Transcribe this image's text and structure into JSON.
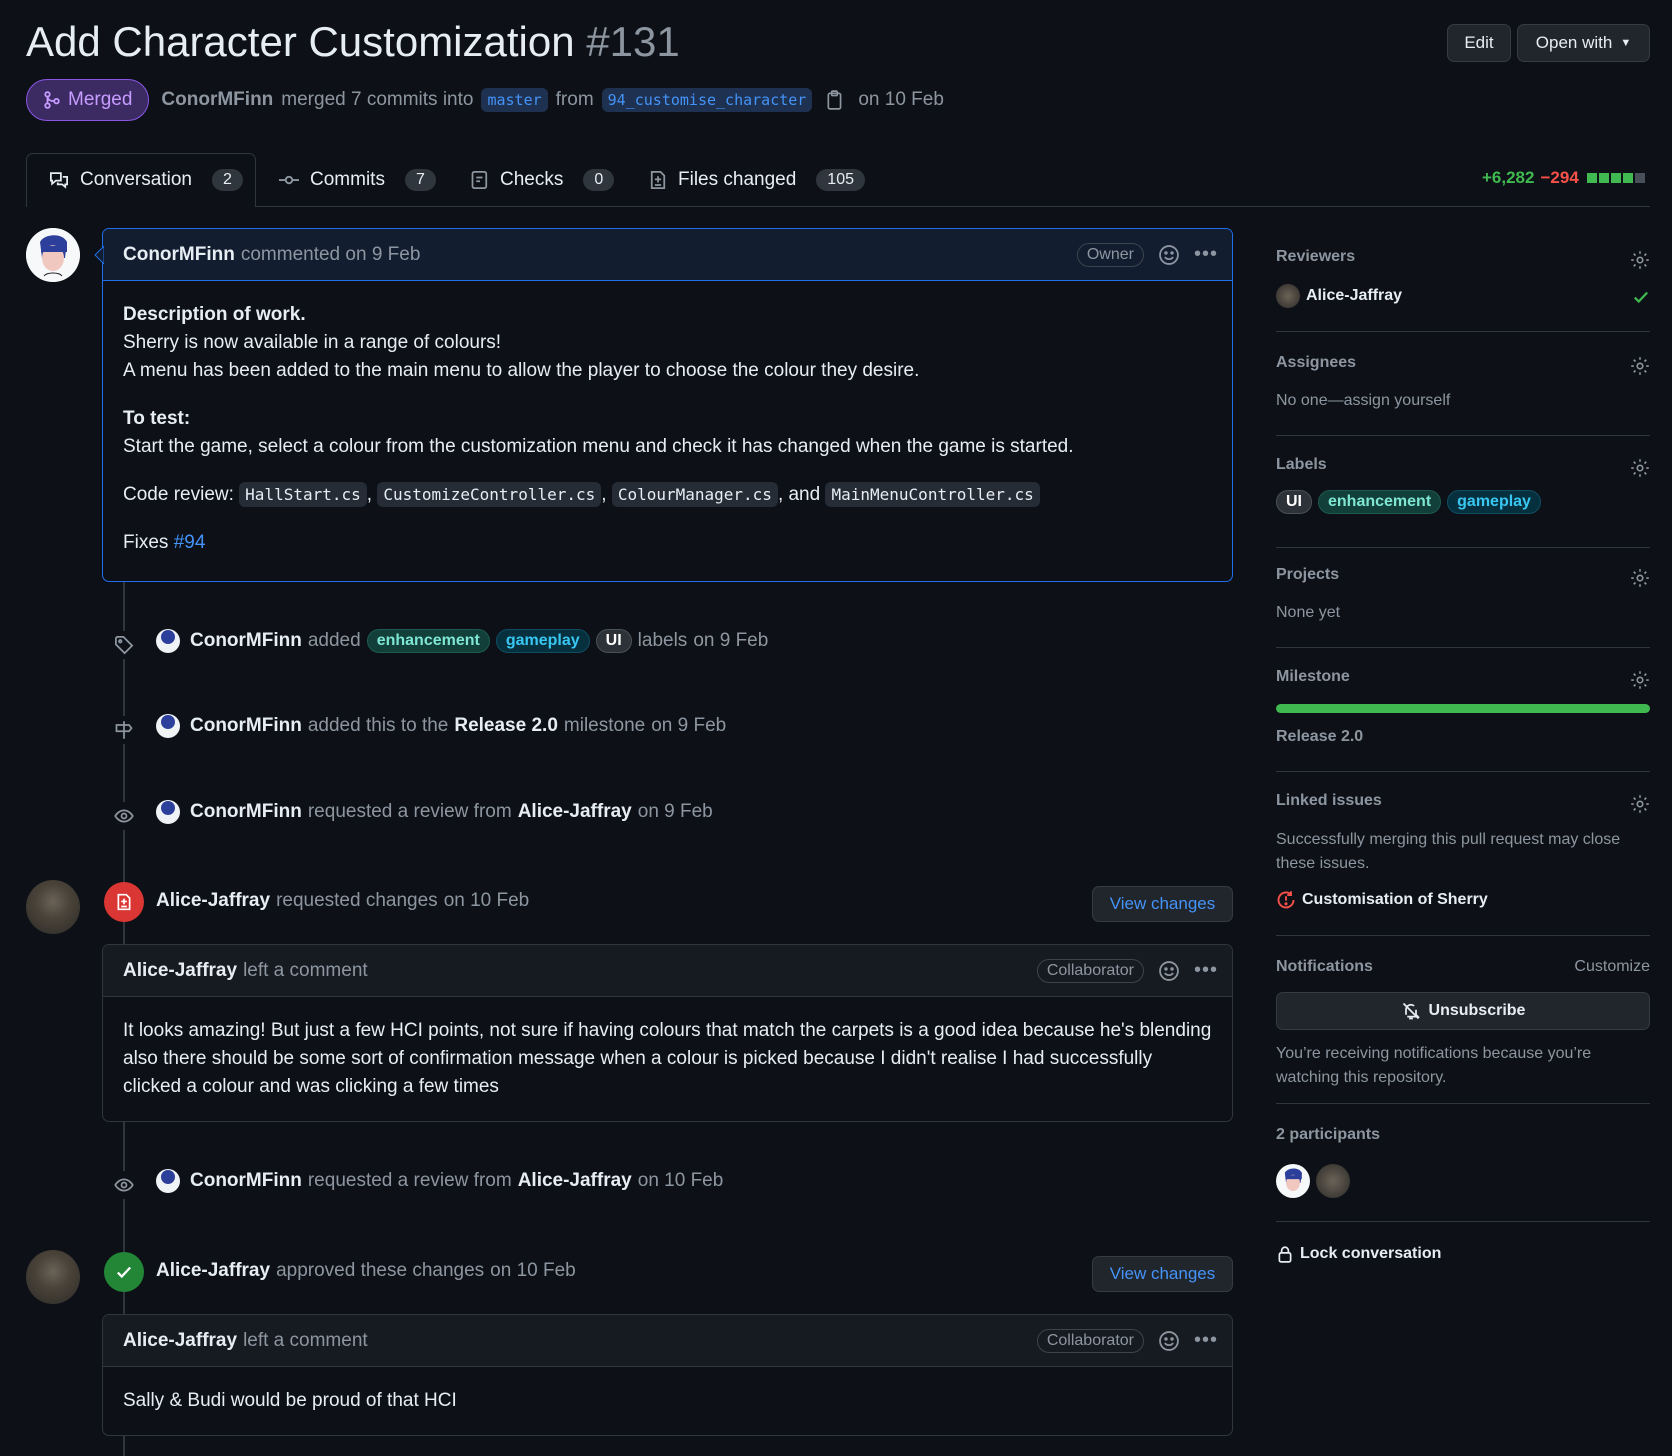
{
  "pr": {
    "title": "Add Character Customization",
    "number": "#131",
    "status": "Merged",
    "author": "ConorMFinn",
    "merged_text": "merged 7 commits into",
    "base_branch": "master",
    "from_text": "from",
    "head_branch": "94_customise_character",
    "date": "on 10 Feb"
  },
  "header_buttons": {
    "edit": "Edit",
    "open_with": "Open with"
  },
  "tabs": [
    {
      "label": "Conversation",
      "count": "2"
    },
    {
      "label": "Commits",
      "count": "7"
    },
    {
      "label": "Checks",
      "count": "0"
    },
    {
      "label": "Files changed",
      "count": "105"
    }
  ],
  "diffstat": {
    "additions": "+6,282",
    "deletions": "−294"
  },
  "comment1": {
    "author": "ConorMFinn",
    "meta": "commented on 9 Feb",
    "badge": "Owner",
    "desc_heading": "Description of work.",
    "line1": "Sherry is now available in a range of colours!",
    "line2": "A menu has been added to the main menu to allow the player to choose the colour they desire.",
    "test_heading": "To test:",
    "test_line": "Start the game, select a colour from the customization menu and check it has changed when the game is started.",
    "code_review_label": "Code review:",
    "files": [
      "HallStart.cs",
      "CustomizeController.cs",
      "ColourManager.cs",
      "MainMenuController.cs"
    ],
    "comma": ",",
    "and_text": ", and",
    "fixes_label": "Fixes",
    "fixes_issue": "#94"
  },
  "events": {
    "labels": {
      "actor": "ConorMFinn",
      "verb": "added",
      "suffix": "labels",
      "date": "on 9 Feb"
    },
    "milestone": {
      "actor": "ConorMFinn",
      "verb": "added this to the",
      "name": "Release 2.0",
      "suffix": "milestone",
      "date": "on 9 Feb"
    },
    "review_req1": {
      "actor": "ConorMFinn",
      "verb": "requested a review from",
      "target": "Alice-Jaffray",
      "date": "on 9 Feb"
    },
    "changes_req": {
      "actor": "Alice-Jaffray",
      "verb": "requested changes",
      "date": "on 10 Feb",
      "button": "View changes"
    },
    "review_req2": {
      "actor": "ConorMFinn",
      "verb": "requested a review from",
      "target": "Alice-Jaffray",
      "date": "on 10 Feb"
    },
    "approved": {
      "actor": "Alice-Jaffray",
      "verb": "approved these changes",
      "date": "on 10 Feb",
      "button": "View changes"
    }
  },
  "comment2": {
    "author": "Alice-Jaffray",
    "meta": "left a comment",
    "badge": "Collaborator",
    "body": "It looks amazing! But just a few HCI points, not sure if having colours that match the carpets is a good idea because he's blending also there should be some sort of confirmation message when a colour is picked because I didn't realise I had successfully clicked a colour and was clicking a few times"
  },
  "comment3": {
    "author": "Alice-Jaffray",
    "meta": "left a comment",
    "badge": "Collaborator",
    "body": "Sally & Budi would be proud of that HCI"
  },
  "labels": {
    "enhancement": "enhancement",
    "gameplay": "gameplay",
    "ui": "UI"
  },
  "sidebar": {
    "reviewers": {
      "title": "Reviewers",
      "name": "Alice-Jaffray"
    },
    "assignees": {
      "title": "Assignees",
      "text": "No one—assign yourself"
    },
    "labels_title": "Labels",
    "projects": {
      "title": "Projects",
      "text": "None yet"
    },
    "milestone": {
      "title": "Milestone",
      "name": "Release 2.0",
      "progress": 1.0
    },
    "linked": {
      "title": "Linked issues",
      "text": "Successfully merging this pull request may close these issues.",
      "issue": "Customisation of Sherry"
    },
    "notifications": {
      "title": "Notifications",
      "customize": "Customize",
      "button": "Unsubscribe",
      "text": "You’re receiving notifications because you’re watching this repository."
    },
    "participants": {
      "title": "2 participants"
    },
    "lock": "Lock conversation"
  },
  "colors": {
    "accent": "#4493f8",
    "merged": "#ab7df8",
    "success": "#3fb950",
    "danger": "#f85149",
    "bg": "#0d1117"
  }
}
